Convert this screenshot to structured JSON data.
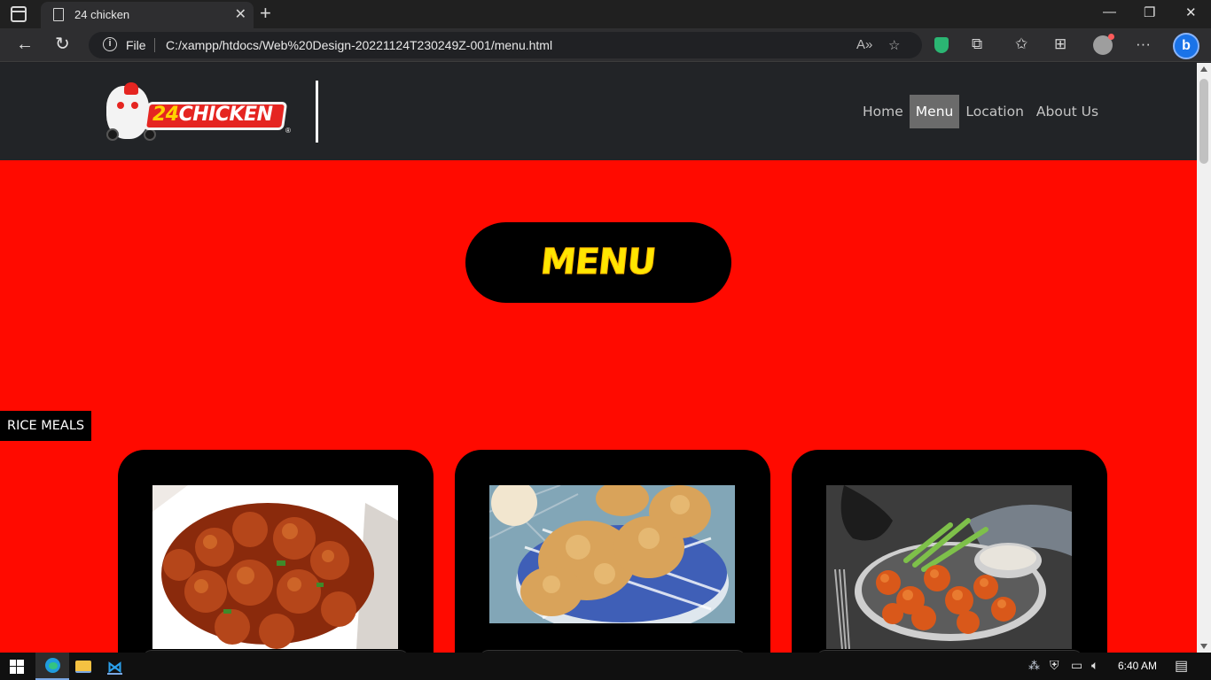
{
  "browser": {
    "tab_title": "24 chicken",
    "address_prefix": "File",
    "url": "C:/xampp/htdocs/Web%20Design-20221124T230249Z-001/menu.html"
  },
  "site": {
    "logo_text_num": "24",
    "logo_text_word": "CHICKEN",
    "logo_reg": "®",
    "nav": [
      {
        "label": "Home",
        "active": false
      },
      {
        "label": "Menu",
        "active": true
      },
      {
        "label": "Location",
        "active": false
      },
      {
        "label": "About Us",
        "active": false
      }
    ],
    "page_heading": "MENU",
    "section_label": "RICE MEALS",
    "cards": [
      {
        "image": "glazed-chicken-box-image"
      },
      {
        "image": "fried-chicken-plate-image"
      },
      {
        "image": "buffalo-wings-image"
      }
    ]
  },
  "taskbar": {
    "time": "6:40 AM"
  },
  "colors": {
    "page_red": "#ff0a00",
    "header_dark": "#222427",
    "heading_yellow": "#ffe600",
    "nav_active_bg": "#6b6b6b"
  }
}
